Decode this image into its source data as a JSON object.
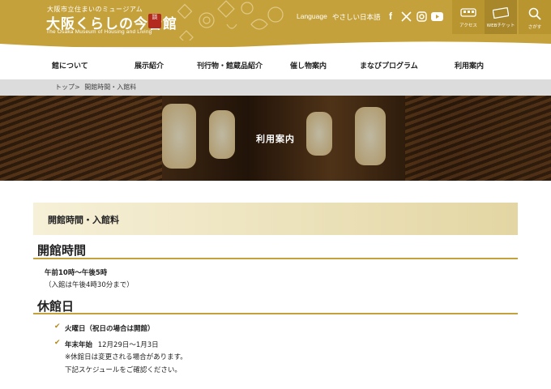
{
  "header": {
    "logo_small": "大阪市立住まいのミュージアム",
    "logo_main": "大阪くらしの今昔館",
    "logo_stamp": "談",
    "logo_en": "The Osaka Museum of Housing and Living",
    "language_label": "Language",
    "easy_japanese_label": "やさしい日本語",
    "social_icons": [
      "facebook-icon",
      "x-icon",
      "instagram-icon",
      "youtube-icon"
    ],
    "buttons": [
      {
        "label": "アクセス",
        "icon": "train-icon"
      },
      {
        "label": "WEBチケット",
        "icon": "ticket-icon"
      },
      {
        "label": "さがす",
        "icon": "search-icon"
      }
    ],
    "brand_color": "#c4a13a"
  },
  "nav": {
    "items": [
      "館について",
      "展示紹介",
      "刊行物・館蔵品紹介",
      "催し物案内",
      "まなびプログラム",
      "利用案内"
    ]
  },
  "breadcrumb": {
    "home": "トップ",
    "separator": ">",
    "current": "開館時間・入館料"
  },
  "hero": {
    "title": "利用案内"
  },
  "page": {
    "heading": "開館時間・入館料",
    "hours": {
      "title": "開館時間",
      "time": "午前10時〜午後5時",
      "note": "（入館は午後4時30分まで）"
    },
    "closed": {
      "title": "休館日",
      "items": [
        {
          "label": "火曜日（祝日の場合は開館）",
          "detail": ""
        },
        {
          "label": "年末年始",
          "detail": "12月29日〜1月3日"
        }
      ],
      "notes": [
        "※休館日は変更される場合があります。",
        "下記スケジュールをご確認ください。"
      ]
    }
  }
}
